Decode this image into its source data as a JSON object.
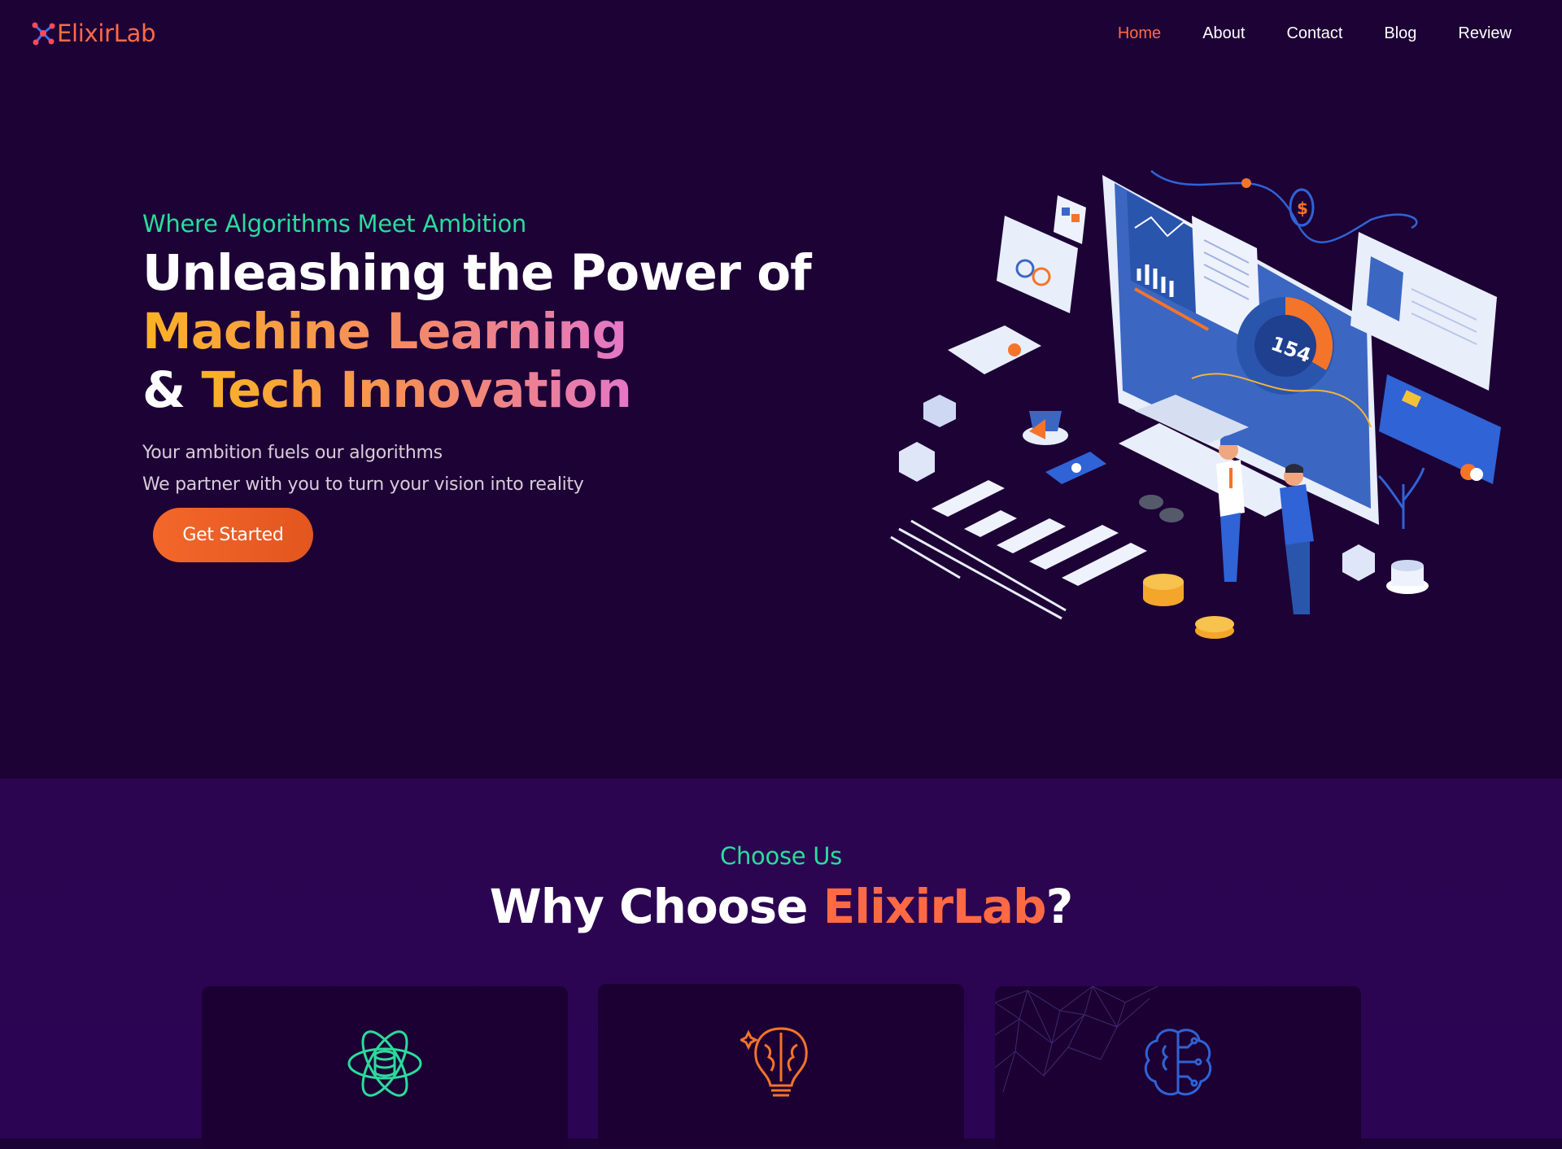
{
  "brand": {
    "name": "ElixirLab",
    "accent": "#ff6a45",
    "tagline_color": "#2bdc9c",
    "background": "#1d0236"
  },
  "nav": {
    "items": [
      {
        "label": "Home",
        "active": true
      },
      {
        "label": "About",
        "active": false
      },
      {
        "label": "Contact",
        "active": false
      },
      {
        "label": "Blog",
        "active": false
      },
      {
        "label": "Review",
        "active": false
      }
    ]
  },
  "hero": {
    "tagline": "Where Algorithms Meet Ambition",
    "title_line1": "Unleashing the Power of",
    "title_line2": "Machine Learning",
    "title_line3_prefix": "& ",
    "title_line3_highlight": "Tech Innovation",
    "subtitle_line1": "Your ambition fuels our algorithms",
    "subtitle_line2": "We partner with you to turn your vision into reality",
    "cta_label": "Get Started",
    "illustration_counter": "154",
    "illustration_currency": "$"
  },
  "why": {
    "tag": "Choose Us",
    "title_prefix": "Why Choose ",
    "title_highlight": "ElixirLab",
    "title_suffix": "?",
    "cards": [
      {
        "icon": "atom-database-icon",
        "color": "#2bdc9c"
      },
      {
        "icon": "lightbulb-brain-icon",
        "color": "#f4742a"
      },
      {
        "icon": "circuit-brain-icon",
        "color": "#2f63d6"
      }
    ]
  }
}
